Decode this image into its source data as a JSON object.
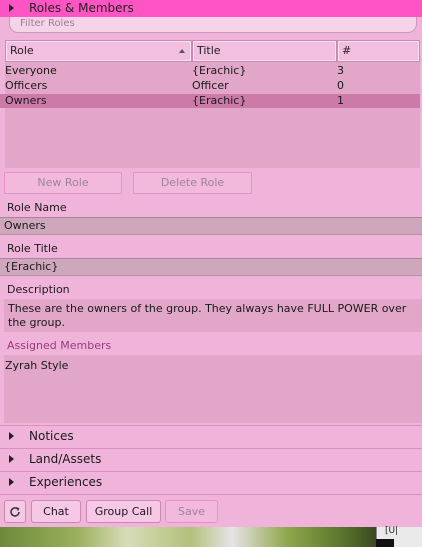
{
  "header": {
    "title": "Roles & Members"
  },
  "filter": {
    "placeholder": "Filter Roles"
  },
  "roles_table": {
    "columns": [
      "Role",
      "Title",
      "#"
    ],
    "rows": [
      {
        "role": "Everyone",
        "title": "{Erachic}",
        "count": "3"
      },
      {
        "role": "Officers",
        "title": "Officer",
        "count": "0"
      },
      {
        "role": "Owners",
        "title": "{Erachic}",
        "count": "1"
      }
    ],
    "selected_row": "Owners"
  },
  "role_buttons": {
    "new_role": "New Role",
    "delete_role": "Delete Role"
  },
  "role_detail": {
    "role_name_label": "Role Name",
    "role_name_value": "Owners",
    "role_title_label": "Role Title",
    "role_title_value": "{Erachic}",
    "description_label": "Description",
    "description_value": "These are the owners of the group.  They always have FULL POWER over the group.",
    "assigned_members_label": "Assigned Members",
    "assigned_members": [
      "Zyrah Style"
    ]
  },
  "sections": {
    "notices": "Notices",
    "land_assets": "Land/Assets",
    "experiences": "Experiences"
  },
  "footer": {
    "chat": "Chat",
    "group_call": "Group Call",
    "save": "Save"
  },
  "corner_tag": {
    "text": "[U|"
  },
  "colors": {
    "header": "#ff55c4",
    "panel": "#f0b4da",
    "selected_row": "#cc7ba8",
    "list_bg": "#e2a6c8"
  }
}
